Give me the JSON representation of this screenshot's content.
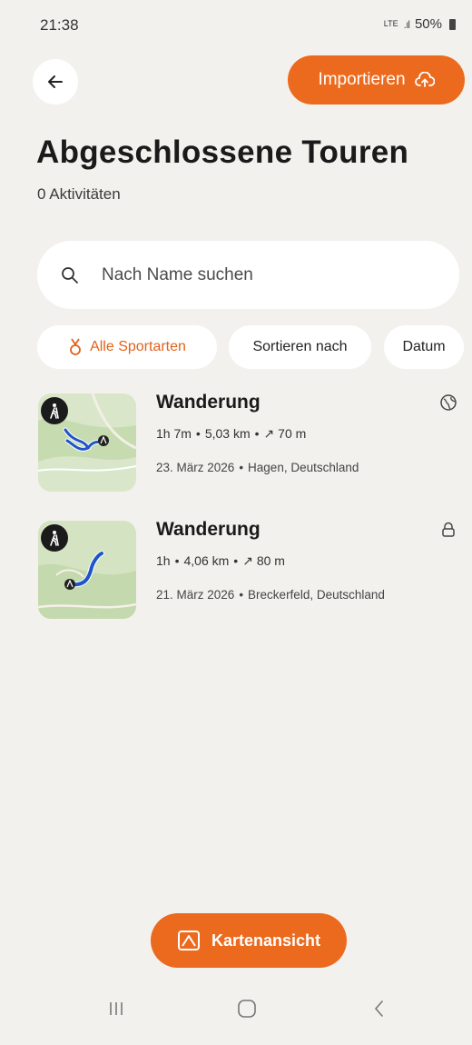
{
  "status_bar": {
    "time": "21:38",
    "network": "LTE",
    "battery": "50%"
  },
  "header": {
    "import_label": "Importieren"
  },
  "page": {
    "title": "Abgeschlossene Touren",
    "subtitle": "0 Aktivitäten"
  },
  "search": {
    "placeholder": "Nach Name suchen",
    "value": ""
  },
  "filters": {
    "sport": "Alle Sportarten",
    "sort": "Sortieren nach",
    "date": "Datum"
  },
  "tours": [
    {
      "title": "Wanderung",
      "duration": "1h 7m",
      "distance": "5,03 km",
      "elevation": "70 m",
      "date": "23. März 2026",
      "location": "Hagen, Deutschland",
      "visibility_icon": "globe-icon"
    },
    {
      "title": "Wanderung",
      "duration": "1h",
      "distance": "4,06 km",
      "elevation": "80 m",
      "date": "21. März 2026",
      "location": "Breckerfeld, Deutschland",
      "visibility_icon": "lock-icon"
    }
  ],
  "map_button": {
    "label": "Kartenansicht"
  },
  "colors": {
    "accent": "#ec6a1d",
    "background": "#f3f1ee",
    "route": "#1f55c8"
  }
}
